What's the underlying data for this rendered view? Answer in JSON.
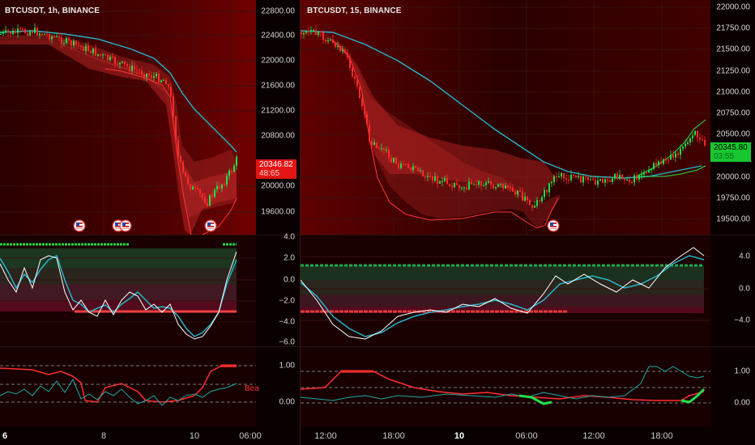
{
  "left": {
    "symbol": "BTCUSDT, 1h, BINANCE",
    "price_ticks": [
      "22800.00",
      "22400.00",
      "22000.00",
      "21600.00",
      "21200.00",
      "20800.00",
      "20000.00",
      "19600.00"
    ],
    "last_price": "20346.82",
    "countdown": "48:65",
    "osc_ticks": [
      "4.0",
      "2.0",
      "0.0",
      "−2.0",
      "−4.0",
      "−6.0"
    ],
    "bottom_ticks": [
      "1.00",
      "0.00"
    ],
    "bottom_label": "Bea",
    "x_labels": [
      "6",
      "8",
      "10",
      "06:00"
    ]
  },
  "right": {
    "symbol": "BTCUSDT, 15, BINANCE",
    "price_ticks": [
      "22000.00",
      "21750.00",
      "21500.00",
      "21250.00",
      "21000.00",
      "20750.00",
      "20500.00",
      "20000.00",
      "19750.00",
      "19500.00"
    ],
    "last_price": "20345.80",
    "countdown": "03:55",
    "osc_ticks": [
      "4.0",
      "0.0",
      "−4.0"
    ],
    "bottom_ticks": [
      "1.00",
      "0.00"
    ],
    "x_labels": [
      "12:00",
      "18:00",
      "10",
      "06:00",
      "12:00",
      "18:00"
    ]
  },
  "colors": {
    "up": "#22e04a",
    "down": "#ff2a2a",
    "ma": "#26b5c9",
    "price_tag_left": "#e31414",
    "price_tag_right": "#18c72f"
  },
  "icons": [
    "us-flag-event-icon"
  ]
}
